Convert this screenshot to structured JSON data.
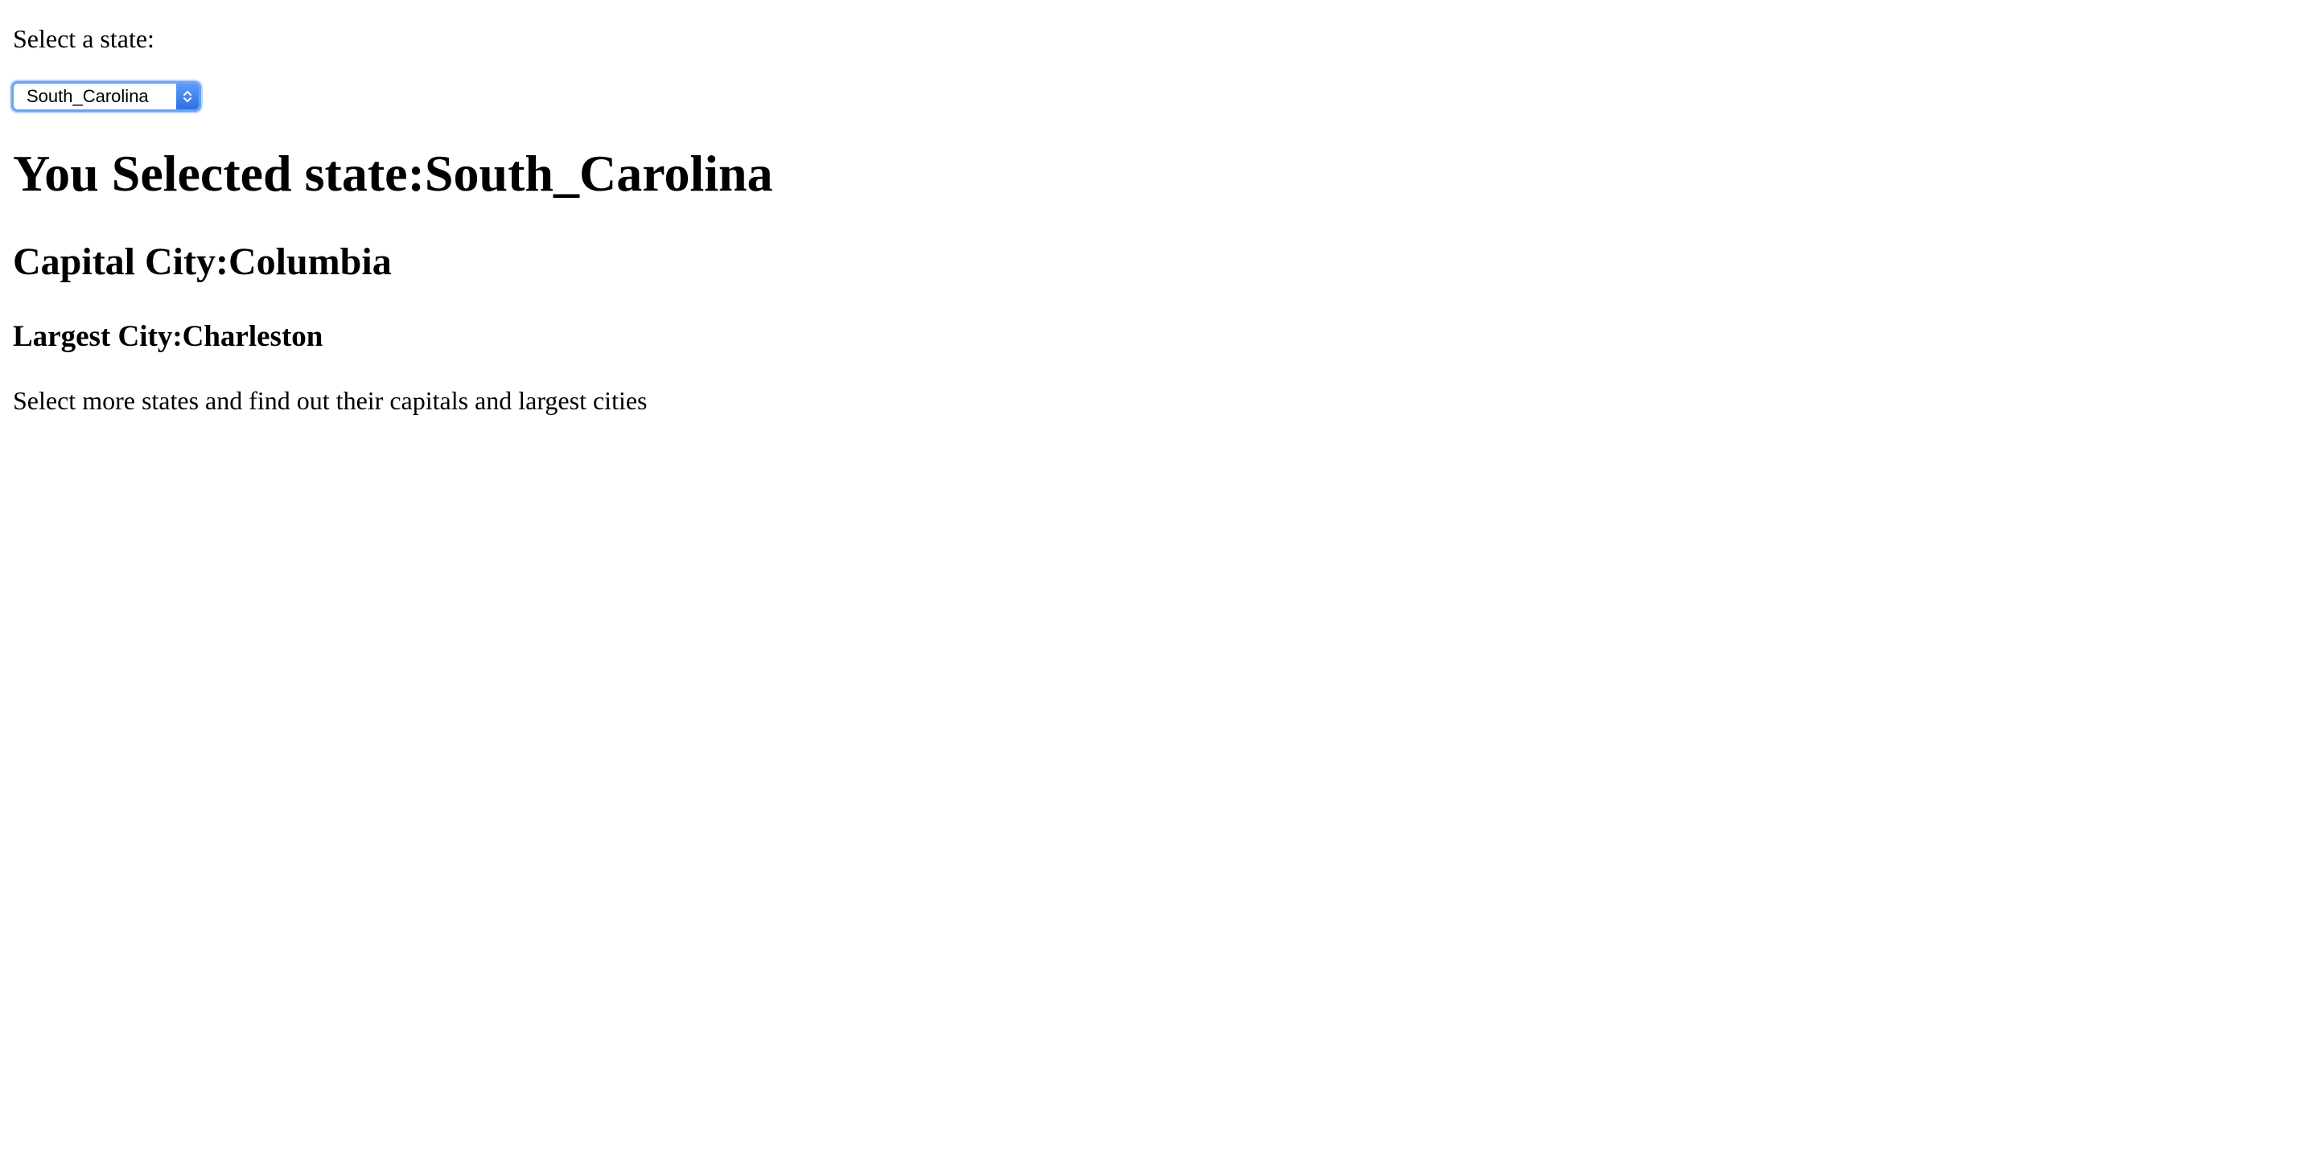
{
  "form": {
    "label": "Select a state:",
    "select": {
      "selected_value": "South_Carolina",
      "accent_color": "#2f6fe4"
    }
  },
  "result": {
    "heading": "You Selected state:South_Carolina",
    "capital": "Capital City:Columbia",
    "largest": "Largest City:Charleston"
  },
  "footer": {
    "text": "Select more states and find out their capitals and largest cities"
  },
  "icons": {
    "select_arrows": "chevron-up-down-icon"
  }
}
